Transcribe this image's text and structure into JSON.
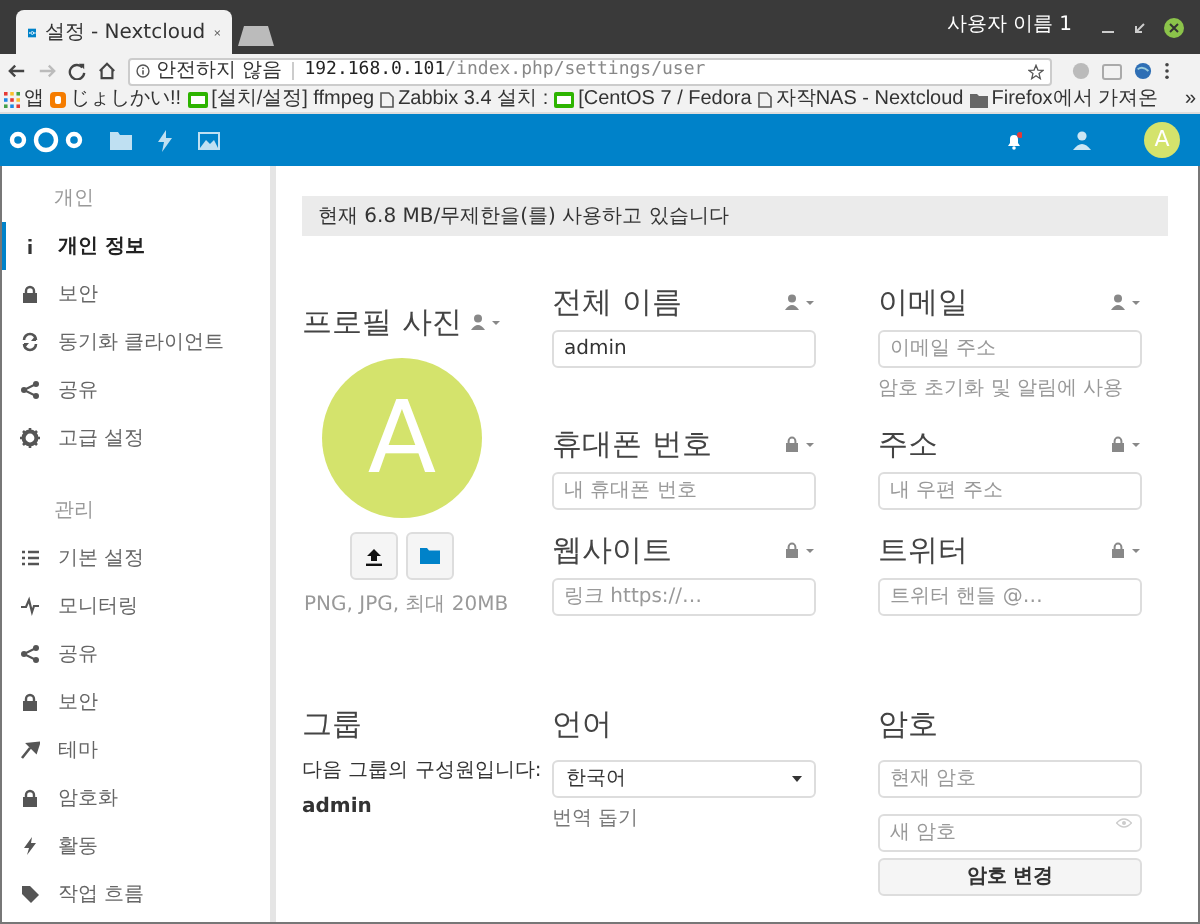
{
  "browser": {
    "tab_title": "설정 - Nextcloud",
    "user": "사용자 이름 1",
    "security": "안전하지 않음",
    "url_host": "192.168.0.101",
    "url_path": "/index.php/settings/user",
    "bookmarks": [
      {
        "label": "앱",
        "kind": "apps"
      },
      {
        "label": "じょしかい!!",
        "kind": "blog"
      },
      {
        "label": "[설치/설정] ffmpeg",
        "kind": "naver"
      },
      {
        "label": "Zabbix 3.4 설치 :",
        "kind": "page"
      },
      {
        "label": "[CentOS 7 / Fedora",
        "kind": "naver"
      },
      {
        "label": "자작NAS - Nextcloud",
        "kind": "page"
      },
      {
        "label": "Firefox에서 가져온",
        "kind": "folder"
      }
    ],
    "more": "»"
  },
  "header": {
    "avatar": "A"
  },
  "sidebar": [
    {
      "heading": "개인",
      "items": [
        {
          "label": "개인 정보",
          "kind": "info",
          "selected": true
        },
        {
          "label": "보안",
          "kind": "lock",
          "selected": false
        },
        {
          "label": "동기화 클라이언트",
          "kind": "sync",
          "selected": false
        },
        {
          "label": "공유",
          "kind": "share",
          "selected": false
        },
        {
          "label": "고급 설정",
          "kind": "gear",
          "selected": false
        }
      ]
    },
    {
      "heading": "관리",
      "items": [
        {
          "label": "기본 설정",
          "kind": "list",
          "selected": false
        },
        {
          "label": "모니터링",
          "kind": "pulse",
          "selected": false
        },
        {
          "label": "공유",
          "kind": "share",
          "selected": false
        },
        {
          "label": "보안",
          "kind": "lock",
          "selected": false
        },
        {
          "label": "테마",
          "kind": "brush",
          "selected": false
        },
        {
          "label": "암호화",
          "kind": "lock",
          "selected": false
        },
        {
          "label": "활동",
          "kind": "bolt",
          "selected": false
        },
        {
          "label": "작업 흐름",
          "kind": "tag",
          "selected": false
        }
      ]
    }
  ],
  "usage": "현재 6.8 MB/무제한을(를) 사용하고 있습니다",
  "profile": {
    "title": "프로필 사진",
    "kind": "contacts",
    "avatar": "A",
    "hint": "PNG, JPG, 최대 20MB"
  },
  "fields": [
    {
      "label": "전체 이름",
      "kind": "contacts",
      "value": "admin"
    },
    {
      "label": "이메일",
      "kind": "contacts",
      "placeholder": "이메일 주소",
      "hint": "암호 초기화 및 알림에 사용"
    },
    {
      "label": "휴대폰 번호",
      "kind": "private",
      "placeholder": "내 휴대폰 번호"
    },
    {
      "label": "주소",
      "kind": "private",
      "placeholder": "내 우편 주소"
    },
    {
      "label": "웹사이트",
      "kind": "private",
      "placeholder": "링크 https://…"
    },
    {
      "label": "트위터",
      "kind": "private",
      "placeholder": "트위터 핸들 @…"
    }
  ],
  "groups": {
    "title": "그룹",
    "text": "다음 그룹의 구성원입니다:",
    "value": "admin"
  },
  "language": {
    "title": "언어",
    "value": "한국어",
    "link": "번역 돕기"
  },
  "password": {
    "title": "암호",
    "current_placeholder": "현재 암호",
    "new_placeholder": "새 암호",
    "button": "암호 변경"
  }
}
